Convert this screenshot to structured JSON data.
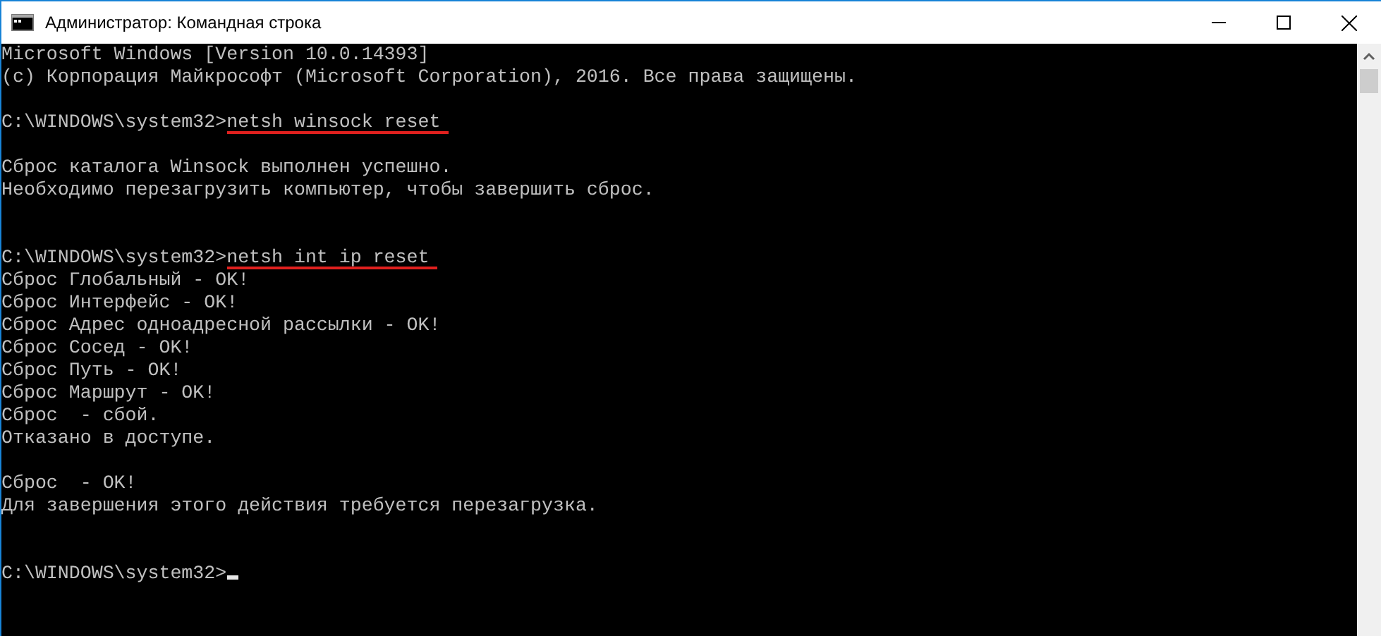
{
  "window": {
    "title": "Администратор: Командная строка"
  },
  "console": {
    "lines": [
      {
        "kind": "output",
        "text": "Microsoft Windows [Version 10.0.14393]"
      },
      {
        "kind": "output",
        "text": "(c) Корпорация Майкрософт (Microsoft Corporation), 2016. Все права защищены."
      },
      {
        "kind": "blank"
      },
      {
        "kind": "prompt",
        "prompt": "C:\\WINDOWS\\system32>",
        "command": "netsh winsock reset",
        "underlined": true
      },
      {
        "kind": "blank"
      },
      {
        "kind": "output",
        "text": "Сброс каталога Winsock выполнен успешно."
      },
      {
        "kind": "output",
        "text": "Необходимо перезагрузить компьютер, чтобы завершить сброс."
      },
      {
        "kind": "blank"
      },
      {
        "kind": "blank"
      },
      {
        "kind": "prompt",
        "prompt": "C:\\WINDOWS\\system32>",
        "command": "netsh int ip reset",
        "underlined": true
      },
      {
        "kind": "output",
        "text": "Сброс Глобальный - OK!"
      },
      {
        "kind": "output",
        "text": "Сброс Интерфейс - OK!"
      },
      {
        "kind": "output",
        "text": "Сброс Адрес одноадресной рассылки - OK!"
      },
      {
        "kind": "output",
        "text": "Сброс Сосед - OK!"
      },
      {
        "kind": "output",
        "text": "Сброс Путь - OK!"
      },
      {
        "kind": "output",
        "text": "Сброс Маршрут - OK!"
      },
      {
        "kind": "output",
        "text": "Сброс  - сбой."
      },
      {
        "kind": "output",
        "text": "Отказано в доступе."
      },
      {
        "kind": "blank"
      },
      {
        "kind": "output",
        "text": "Сброс  - OK!"
      },
      {
        "kind": "output",
        "text": "Для завершения этого действия требуется перезагрузка."
      },
      {
        "kind": "blank"
      },
      {
        "kind": "blank"
      },
      {
        "kind": "prompt",
        "prompt": "C:\\WINDOWS\\system32>",
        "cursor": true
      }
    ]
  }
}
